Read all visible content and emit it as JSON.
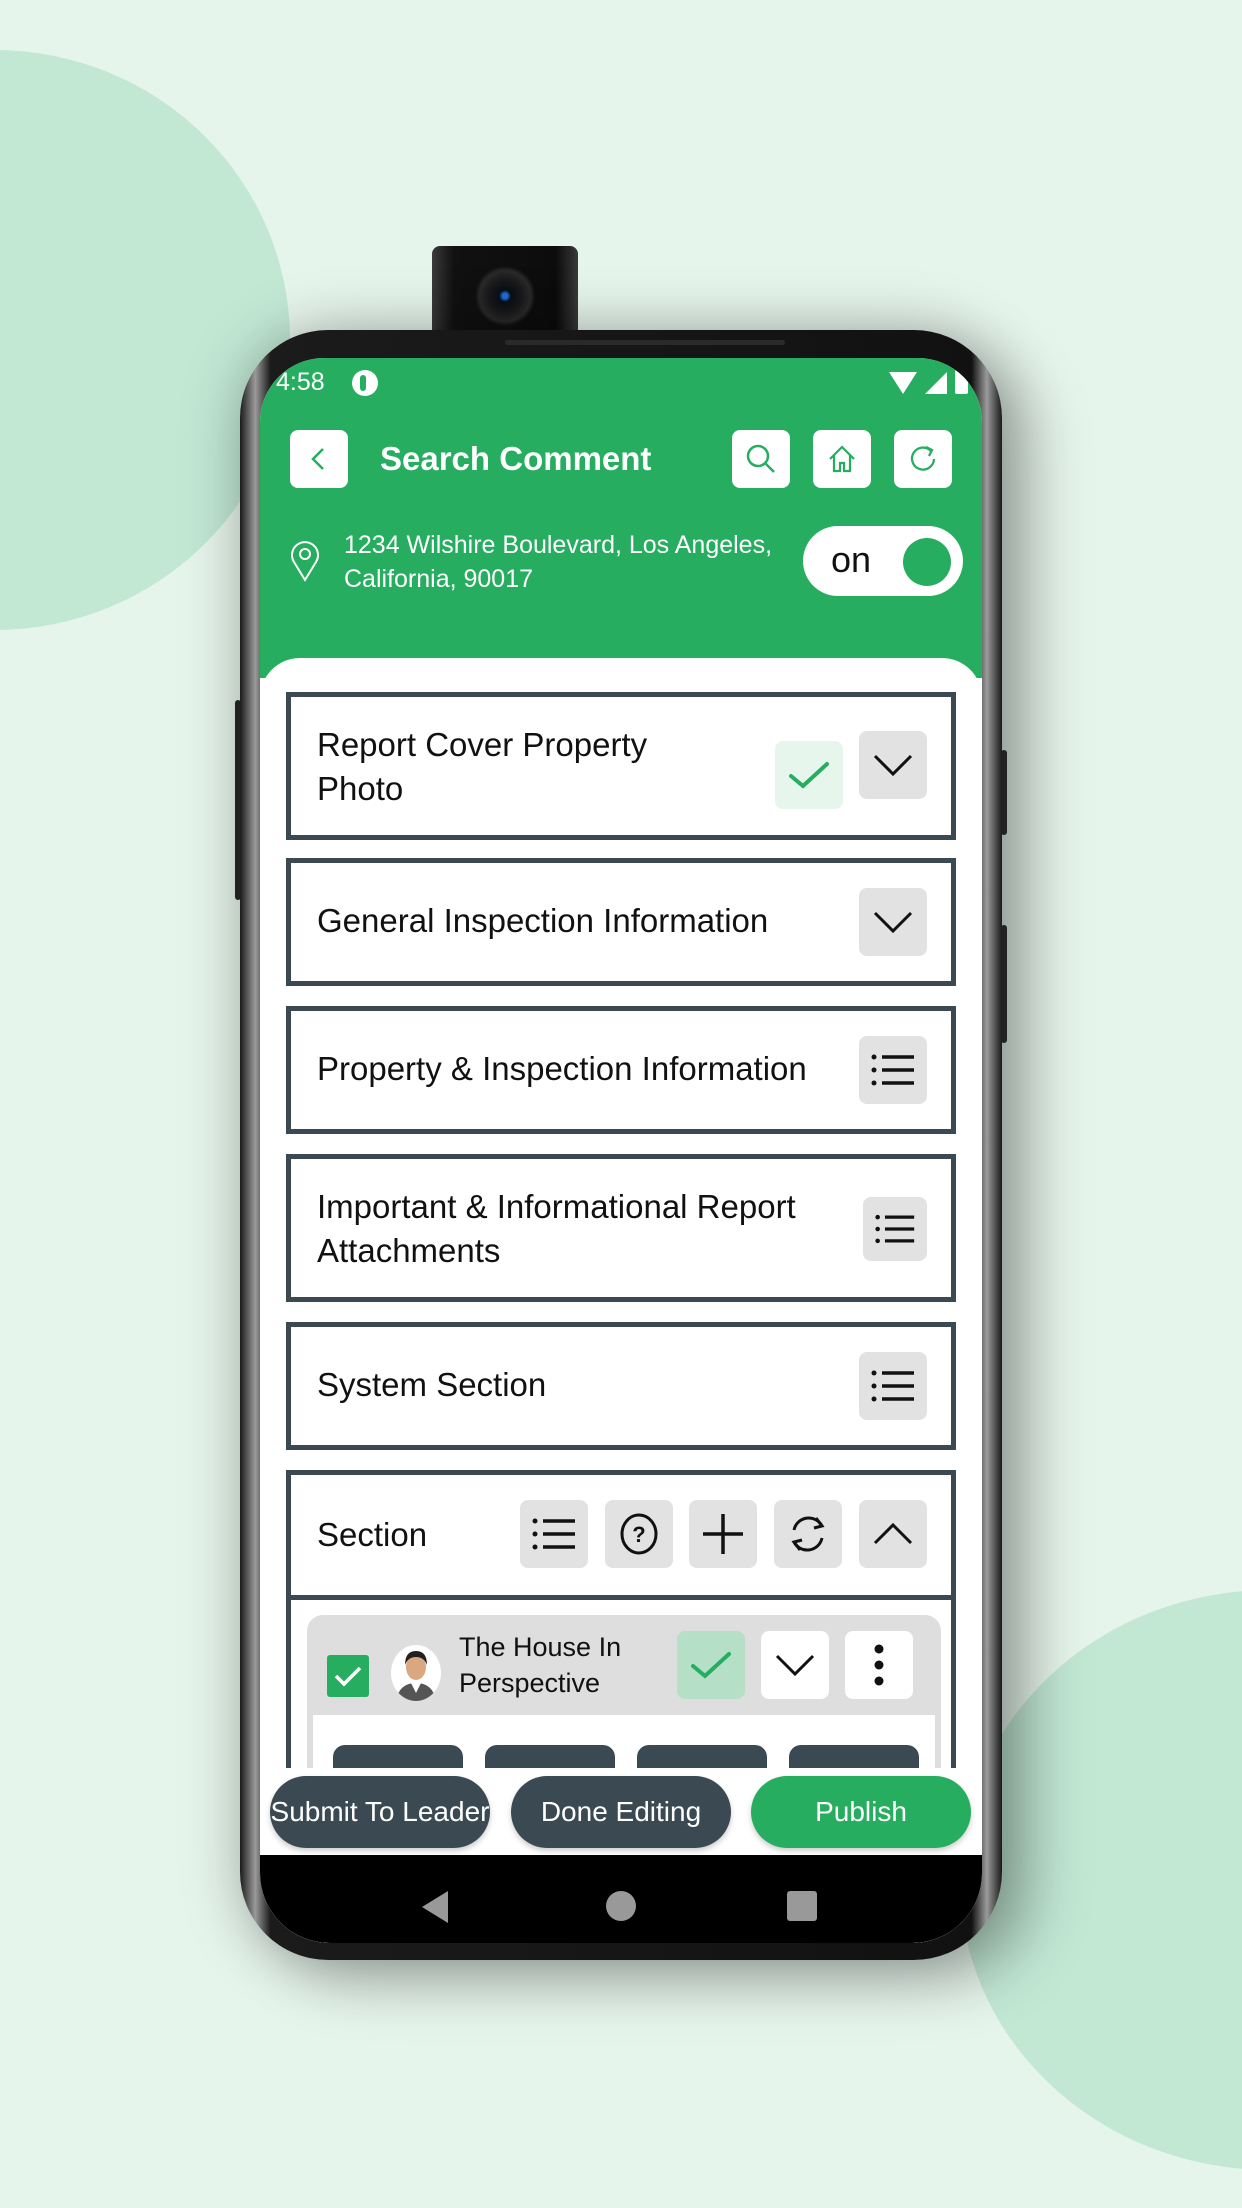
{
  "status_bar": {
    "time": "4:58"
  },
  "header": {
    "title": "Search Comment",
    "address_line1": "1234 Wilshire Boulevard, Los Angeles,",
    "address_line2": "California, 90017",
    "toggle_label": "on",
    "toggle_state": true
  },
  "colors": {
    "brand_green": "#26ad5f",
    "dark_slate": "#3b4a52",
    "icon_bg": "#e2e2e2"
  },
  "sections": [
    {
      "label_line1": "Report Cover Property",
      "label_line2": "Photo",
      "completed": true,
      "action": "chevron-down"
    },
    {
      "label_line1": "General Inspection Information",
      "action": "chevron-down"
    },
    {
      "label_line1": "Property & Inspection Information",
      "action": "list"
    },
    {
      "label_line1": "Important & Informational Report",
      "label_line2": "Attachments",
      "action": "list"
    },
    {
      "label_line1": "System Section",
      "action": "list"
    },
    {
      "label_line1": "Section",
      "actions": [
        "list",
        "help",
        "add",
        "sync",
        "chevron-up"
      ]
    }
  ],
  "sub_item": {
    "title_line1": "The House In",
    "title_line2": "Perspective",
    "checked": true,
    "completed": true
  },
  "footer": {
    "submit_label": "Submit To Leader",
    "done_label": "Done Editing",
    "publish_label": "Publish"
  }
}
